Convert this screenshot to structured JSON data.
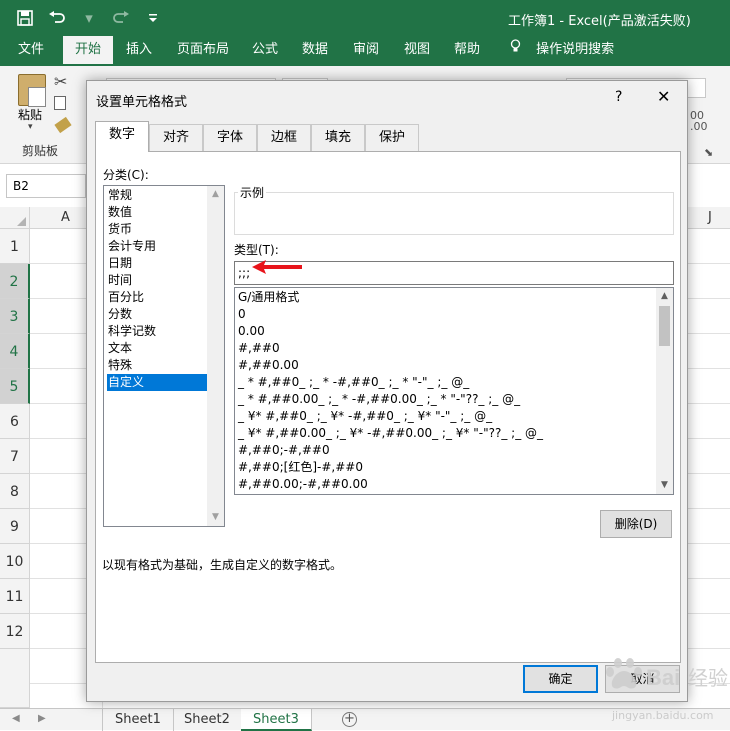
{
  "titlebar": {
    "window_title": "工作簿1  -  Excel(产品激活失败)",
    "qat": {
      "save_icon": "save-icon",
      "undo_icon": "undo-icon",
      "redo_icon": "redo-icon",
      "customize_icon": "customize-qat-icon"
    }
  },
  "ribbon_tabs": [
    {
      "label": "文件",
      "active": false
    },
    {
      "label": "开始",
      "active": true
    },
    {
      "label": "插入",
      "active": false
    },
    {
      "label": "页面布局",
      "active": false
    },
    {
      "label": "公式",
      "active": false
    },
    {
      "label": "数据",
      "active": false
    },
    {
      "label": "审阅",
      "active": false
    },
    {
      "label": "视图",
      "active": false
    },
    {
      "label": "帮助",
      "active": false
    },
    {
      "label": "操作说明搜索",
      "active": false
    }
  ],
  "ribbon": {
    "paste_label": "粘贴",
    "clipboard_group": "剪贴板",
    "partial_right_text": "00\n.00"
  },
  "formula_bar": {
    "name_box": "B2"
  },
  "grid": {
    "col_a": "A",
    "col_j": "J",
    "rows": [
      "1",
      "2",
      "3",
      "4",
      "5",
      "6",
      "7",
      "8",
      "9",
      "10",
      "11",
      "12"
    ],
    "selected_rows": [
      "2",
      "3",
      "4",
      "5"
    ]
  },
  "sheets": {
    "tabs": [
      "Sheet1",
      "Sheet2",
      "Sheet3"
    ],
    "active": "Sheet3",
    "add_icon": "plus-circle-icon"
  },
  "dialog": {
    "title": "设置单元格格式",
    "help": "?",
    "close": "✕",
    "tabs": [
      "数字",
      "对齐",
      "字体",
      "边框",
      "填充",
      "保护"
    ],
    "active_tab": "数字",
    "category_label": "分类(C):",
    "categories": [
      "常规",
      "数值",
      "货币",
      "会计专用",
      "日期",
      "时间",
      "百分比",
      "分数",
      "科学记数",
      "文本",
      "特殊",
      "自定义"
    ],
    "selected_category": "自定义",
    "sample_label": "示例",
    "type_label": "类型(T):",
    "type_value": ";;;",
    "formats": [
      "G/通用格式",
      "0",
      "0.00",
      "#,##0",
      "#,##0.00",
      "_ * #,##0_ ;_ * -#,##0_ ;_ * \"-\"_ ;_ @_",
      "_ * #,##0.00_ ;_ * -#,##0.00_ ;_ * \"-\"??_ ;_ @_",
      "_ ¥* #,##0_ ;_ ¥* -#,##0_ ;_ ¥* \"-\"_ ;_ @_",
      "_ ¥* #,##0.00_ ;_ ¥* -#,##0.00_ ;_ ¥* \"-\"??_ ;_ @_",
      "#,##0;-#,##0",
      "#,##0;[红色]-#,##0",
      "#,##0.00;-#,##0.00"
    ],
    "delete_label": "删除(D)",
    "description": "以现有格式为基础，生成自定义的数字格式。",
    "ok_label": "确定",
    "cancel_label": "取消"
  },
  "annotation": {
    "arrow_color": "#e8141b"
  },
  "watermark": {
    "text": "Baidu 经验",
    "url": "jingyan.baidu.com"
  },
  "colors": {
    "excel_green": "#217346",
    "selection_blue": "#0078d7"
  }
}
